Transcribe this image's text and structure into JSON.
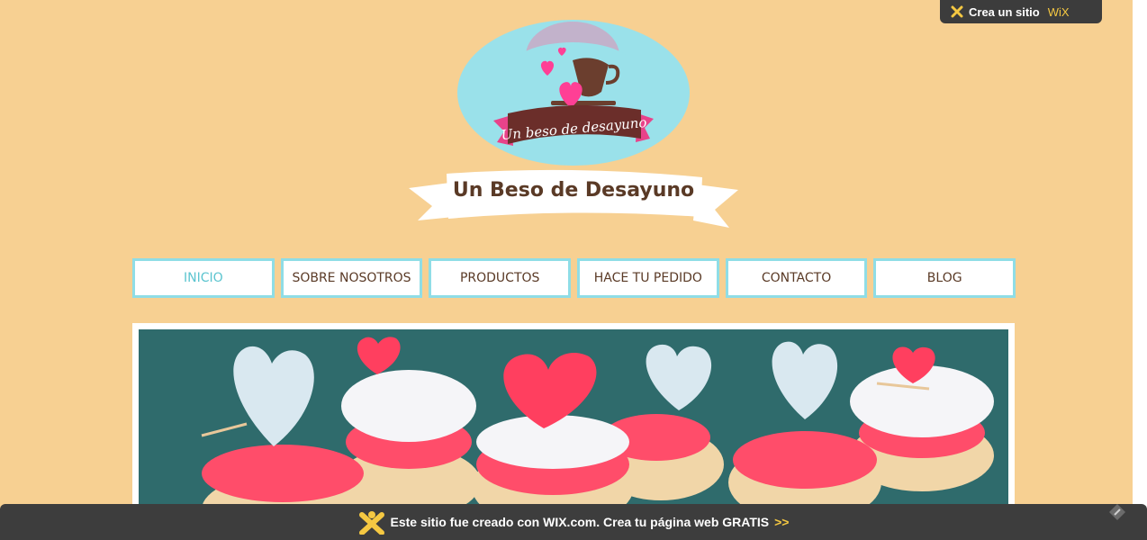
{
  "wix_badge": {
    "label": "Crea un sitio",
    "brand": "WiX"
  },
  "logo": {
    "ribbon_text": "Un beso de desayuno"
  },
  "site_title": "Un Beso de Desayuno",
  "nav": {
    "items": [
      {
        "label": "INICIO",
        "active": true
      },
      {
        "label": "SOBRE NOSOTROS",
        "active": false
      },
      {
        "label": "PRODUCTOS",
        "active": false
      },
      {
        "label": "HACE TU PEDIDO",
        "active": false
      },
      {
        "label": "CONTACTO",
        "active": false
      },
      {
        "label": "BLOG",
        "active": false
      }
    ]
  },
  "promo_bar": {
    "text": "Este sitio fue creado con WIX.com. Crea tu página web GRATIS",
    "arrows": ">>"
  },
  "colors": {
    "background": "#f7d092",
    "nav_border": "#8fdde6",
    "nav_active": "#5bc4cf",
    "text_brown": "#5a3a26",
    "wix_yellow": "#f5c842"
  }
}
